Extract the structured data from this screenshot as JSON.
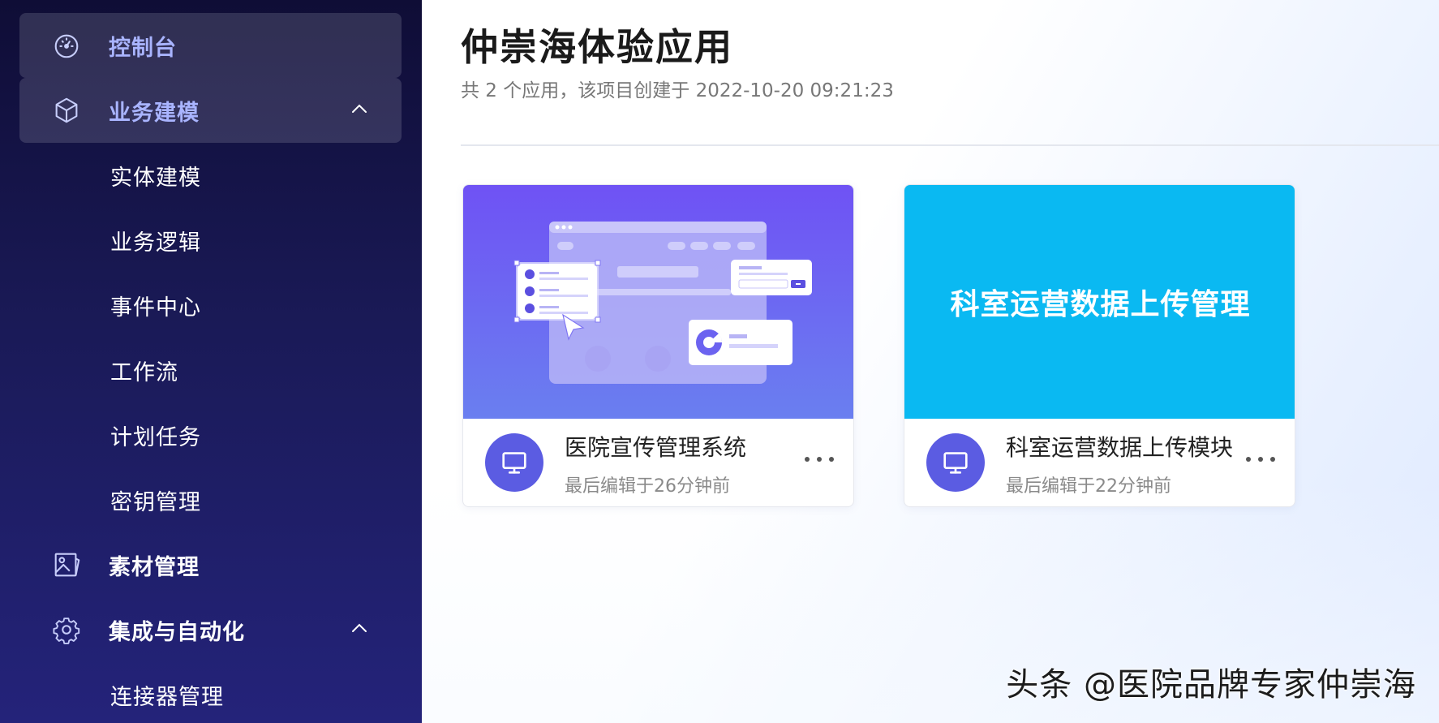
{
  "sidebar": {
    "items": [
      {
        "label": "控制台",
        "icon": "dashboard-icon",
        "active": true
      },
      {
        "label": "业务建模",
        "icon": "cube-icon",
        "expanded": true,
        "children": [
          "实体建模",
          "业务逻辑",
          "事件中心",
          "工作流",
          "计划任务",
          "密钥管理"
        ]
      },
      {
        "label": "素材管理",
        "icon": "image-icon"
      },
      {
        "label": "集成与自动化",
        "icon": "gear-icon",
        "expanded": true,
        "children": [
          "连接器管理"
        ]
      }
    ]
  },
  "main": {
    "title": "仲崇海体验应用",
    "subtitle": "共 2 个应用，该项目创建于 2022-10-20 09:21:23",
    "apps": [
      {
        "name": "医院宣传管理系统",
        "edited": "最后编辑于26分钟前",
        "cover": "illustration"
      },
      {
        "name": "科室运营数据上传模块",
        "edited": "最后编辑于22分钟前",
        "cover_text": "科室运营数据上传管理"
      }
    ]
  },
  "watermark": "头条 @医院品牌专家仲崇海",
  "colors": {
    "sidebar_top": "#0f0d36",
    "sidebar_bottom": "#24237a",
    "accent_text": "#a9b4ff",
    "app_icon": "#5b5ce2",
    "banner_blue": "#0ab9f2",
    "illustration_purple": "#6a5cf6"
  }
}
